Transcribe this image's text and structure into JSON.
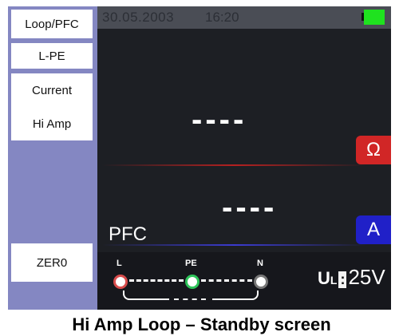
{
  "menu": {
    "items": [
      {
        "label": "Loop/PFC"
      },
      {
        "label": "L-PE"
      },
      {
        "label": "Current"
      },
      {
        "label": "Hi Amp"
      },
      {
        "label": "ZER0"
      }
    ]
  },
  "status": {
    "date": "30.05.2003",
    "time": "16:20",
    "battery_color": "#1fe21f"
  },
  "display": {
    "reading_top": "----",
    "reading_bottom": "----",
    "pfc_label": "PFC",
    "ohm_button": "Ω",
    "amp_button": "A"
  },
  "terminals": {
    "l": "L",
    "pe": "PE",
    "n": "N"
  },
  "ul": {
    "u": "U",
    "sub": "L",
    "colon": ":",
    "value": "25V"
  },
  "caption": "Hi Amp Loop – Standby screen"
}
